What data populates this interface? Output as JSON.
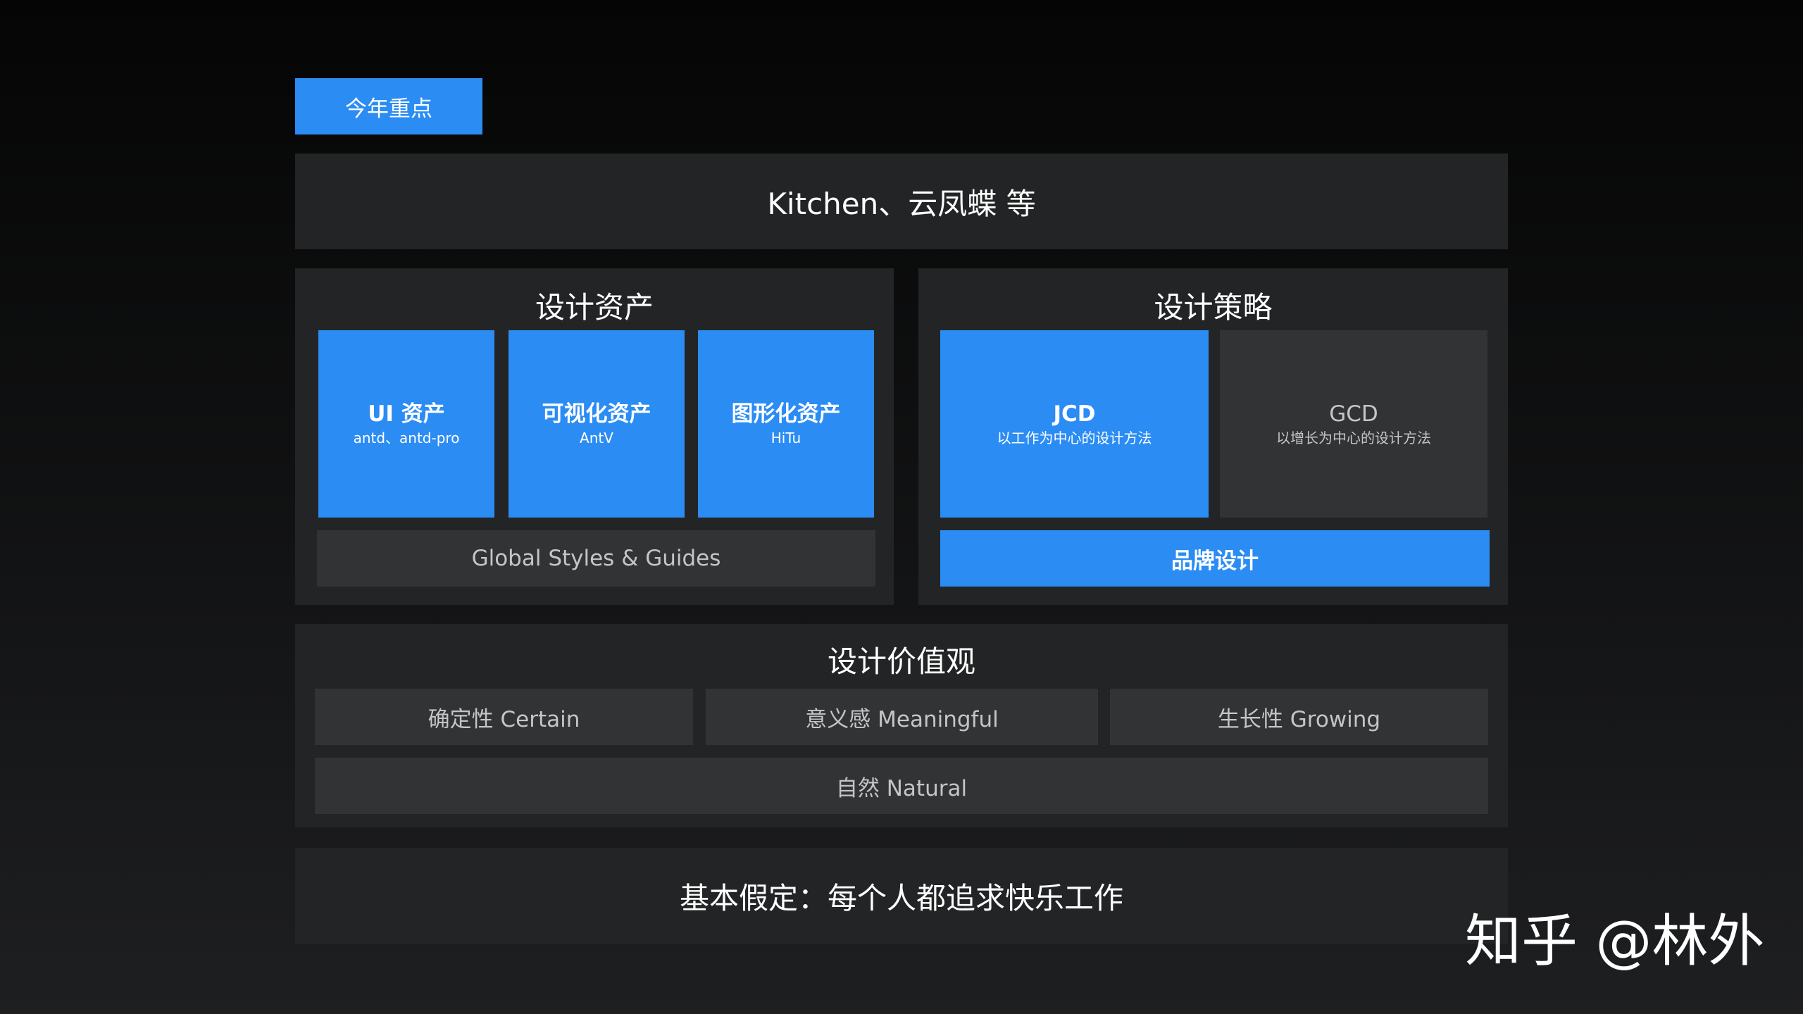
{
  "tag": "今年重点",
  "banner": "Kitchen、云凤蝶 等",
  "design_assets": {
    "title": "设计资产",
    "cards": [
      {
        "title": "UI 资产",
        "subtitle": "antd、antd-pro"
      },
      {
        "title": "可视化资产",
        "subtitle": "AntV"
      },
      {
        "title": "图形化资产",
        "subtitle": "HiTu"
      }
    ],
    "bar": "Global Styles & Guides"
  },
  "design_strategy": {
    "title": "设计策略",
    "jcd": {
      "title": "JCD",
      "subtitle": "以工作为中心的设计方法"
    },
    "gcd": {
      "title": "GCD",
      "subtitle": "以增长为中心的设计方法"
    },
    "bar": "品牌设计"
  },
  "design_values": {
    "title": "设计价值观",
    "items": [
      "确定性 Certain",
      "意义感 Meaningful",
      "生长性 Growing"
    ],
    "bar": "自然 Natural"
  },
  "footer": "基本假定：每个人都追求快乐工作",
  "watermark": "知乎 @林外",
  "colors": {
    "accent_blue": "#2b8cf4",
    "panel": "#232425",
    "grey_card": "#323335",
    "background": "#0a0a0a"
  }
}
